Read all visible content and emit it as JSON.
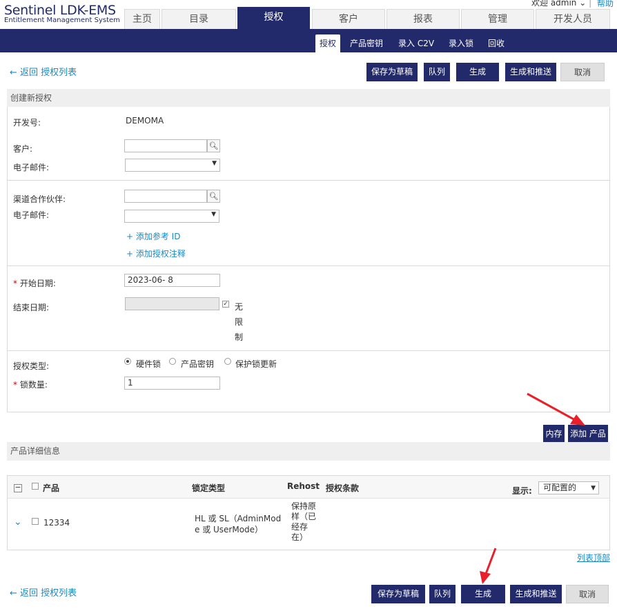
{
  "header": {
    "logo_title": "Sentinel LDK-EMS",
    "logo_subtitle": "Entitlement Management System",
    "welcome": "欢迎 admin",
    "help": "帮助"
  },
  "main_tabs": [
    "主页",
    "目录",
    "授权",
    "客户",
    "报表",
    "管理",
    "开发人员"
  ],
  "sub_tabs": [
    "授权",
    "产品密钥",
    "录入 C2V",
    "录入锁",
    "回收"
  ],
  "actions": {
    "back": "返回 授权列表",
    "save_draft": "保存为草稿",
    "queue": "队列",
    "generate": "生成",
    "generate_push": "生成和推送",
    "cancel": "取消"
  },
  "form": {
    "title": "创建新授权",
    "vendor_label": "开发号:",
    "vendor_value": "DEMOMA",
    "customer_label": "客户:",
    "email_label": "电子邮件:",
    "partner_label": "渠道合作伙伴:",
    "email2_label": "电子邮件:",
    "add_ref": "+ 添加参考 ID",
    "add_note": "+ 添加授权注释",
    "start_label": "开始日期:",
    "start_value": "2023-06- 8",
    "end_label": "结束日期:",
    "unlimited_1": "无",
    "unlimited_2": "限",
    "unlimited_3": "制",
    "type_label": "授权类型:",
    "type_options": [
      "硬件锁",
      "产品密钥",
      "保护锁更新"
    ],
    "qty_label": "锁数量:",
    "qty_value": "1"
  },
  "product_buttons": {
    "memory": "内存",
    "add_product": "添加 产品"
  },
  "products": {
    "title": "产品详细信息",
    "col_product": "产品",
    "col_lock": "锁定类型",
    "col_rehost": "Rehost",
    "col_terms": "授权条款",
    "display_label": "显示:",
    "display_value": "可配置的",
    "rows": [
      {
        "product": "12334",
        "lock_1": "HL 或 SL（AdminMod",
        "lock_2": "e 或 UserMode）",
        "rehost_1": "保持原",
        "rehost_2": "样（已",
        "rehost_3": "经存",
        "rehost_4": "在）"
      }
    ],
    "list_top": "列表顶部"
  },
  "colors": {
    "navy": "#232a6b",
    "link": "#1a8ac6",
    "annotation_arrow": "#e8202a"
  }
}
